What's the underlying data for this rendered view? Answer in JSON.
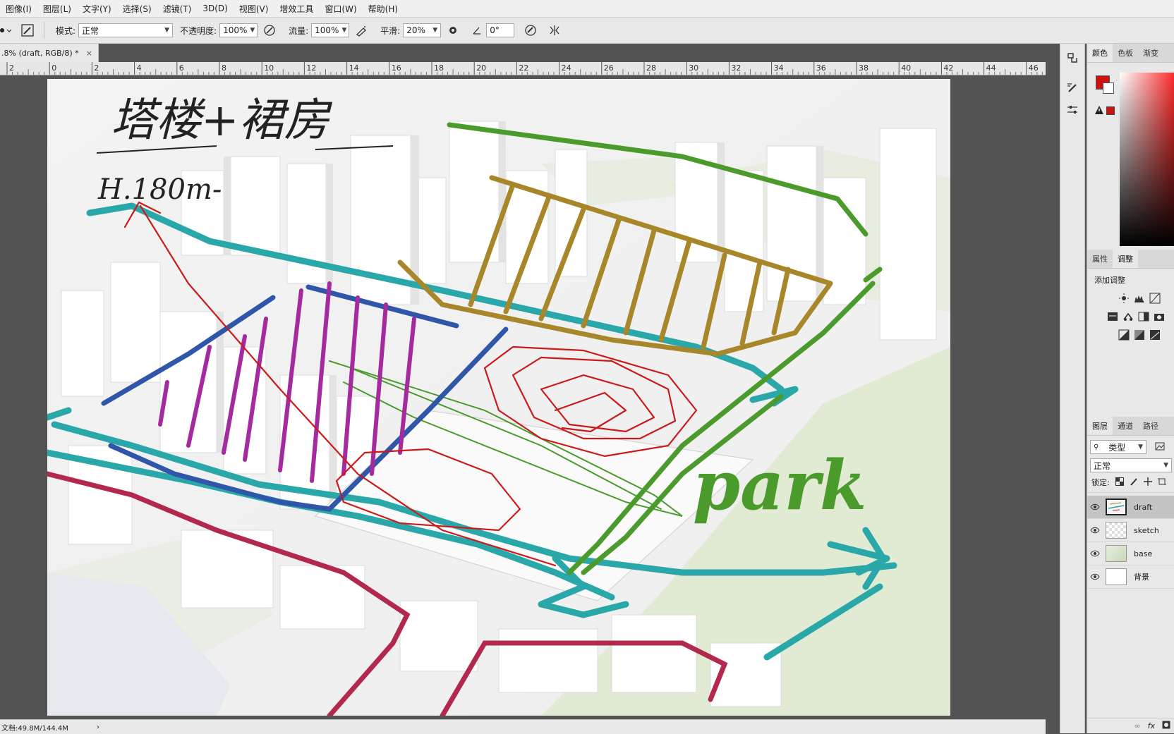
{
  "menu": [
    "图像(I)",
    "图层(L)",
    "文字(Y)",
    "选择(S)",
    "滤镜(T)",
    "3D(D)",
    "视图(V)",
    "增效工具",
    "窗口(W)",
    "帮助(H)"
  ],
  "options": {
    "mode_label": "模式:",
    "mode_value": "正常",
    "opacity_label": "不透明度:",
    "opacity_value": "100%",
    "flow_label": "流量:",
    "flow_value": "100%",
    "smooth_label": "平滑:",
    "smooth_value": "20%",
    "angle_value": "0°"
  },
  "document_tab": {
    "title": ".8% (draft, RGB/8) *",
    "close": "×"
  },
  "ruler_labels": [
    "2",
    "0",
    "2",
    "4",
    "6",
    "8",
    "10",
    "12",
    "14",
    "16",
    "18",
    "20",
    "22",
    "24",
    "26",
    "28",
    "30",
    "32",
    "34",
    "36",
    "38",
    "40",
    "42",
    "44",
    "46"
  ],
  "canvas_sketch": {
    "title_text": "塔楼+裙房",
    "height_text": "H.180m-",
    "park_text": "park"
  },
  "status": {
    "doc_size": "文档:49.8M/144.4M",
    "arrow": "›"
  },
  "color_panel": {
    "tabs": [
      "颜色",
      "色板",
      "渐变"
    ],
    "foreground": "#cc1111",
    "background": "#ffffff"
  },
  "adjust_panel": {
    "tabs": [
      "属性",
      "调整"
    ],
    "add_label": "添加调整"
  },
  "layers_panel": {
    "tabs": [
      "图层",
      "通道",
      "路径"
    ],
    "filter_label": "类型",
    "blend_mode": "正常",
    "lock_label": "锁定:",
    "layers": [
      {
        "name": "draft",
        "selected": true
      },
      {
        "name": "sketch",
        "selected": false
      },
      {
        "name": "base",
        "selected": false
      },
      {
        "name": "背景",
        "selected": false
      }
    ],
    "fx_label": "fx"
  },
  "colors": {
    "teal": "#2aa7a8",
    "olive": "#a8862a",
    "green": "#4a9a2c",
    "blue": "#2f56a8",
    "purple": "#a52aa0",
    "red": "#cc1a1a",
    "crimson": "#b3294e"
  }
}
